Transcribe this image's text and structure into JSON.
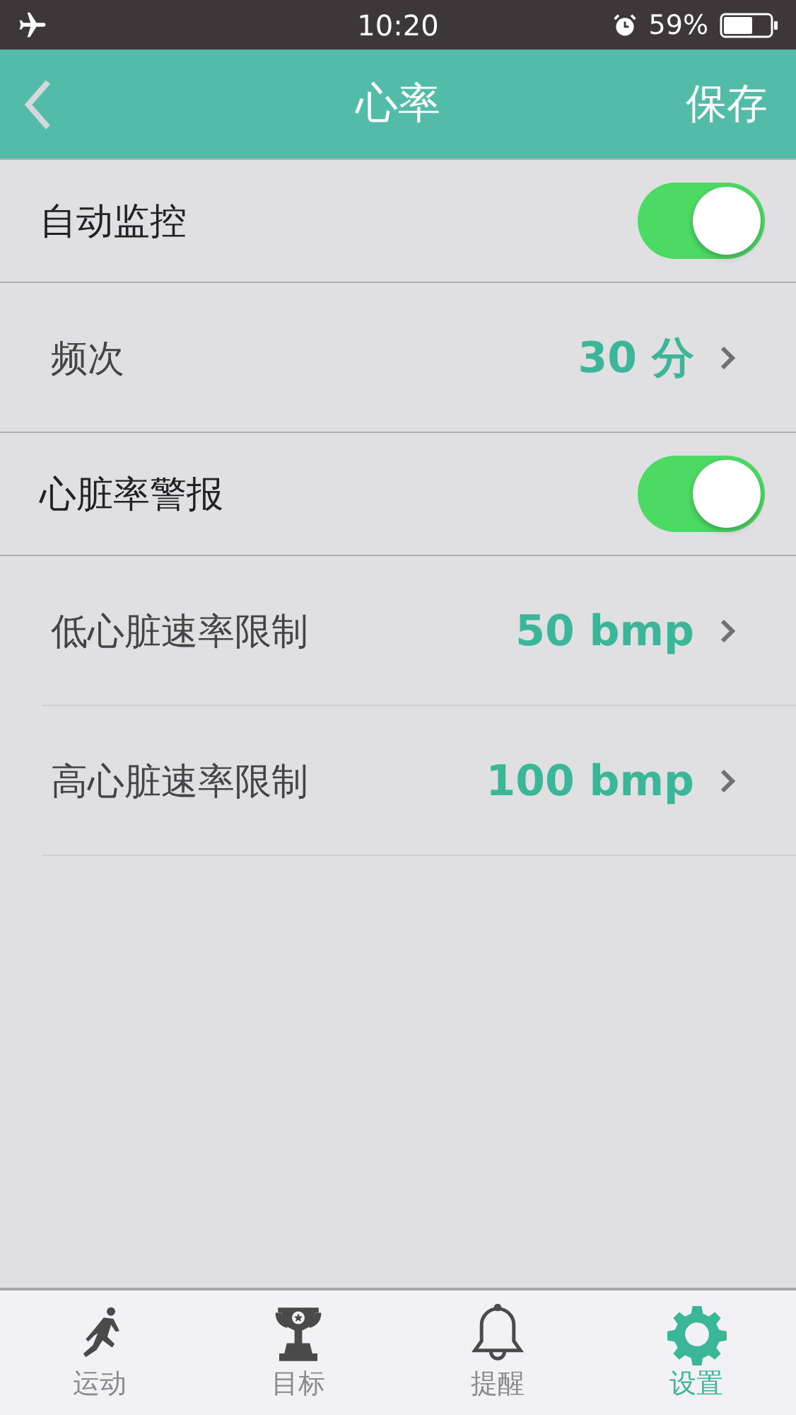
{
  "status_bar": {
    "time": "10:20",
    "battery_text": "59%"
  },
  "nav": {
    "title": "心率",
    "action": "保存"
  },
  "rows": [
    {
      "kind": "toggle",
      "label": "自动监控",
      "on": true
    },
    {
      "kind": "value",
      "label": "频次",
      "value": "30 分"
    },
    {
      "kind": "toggle",
      "label": "心脏率警报",
      "on": true
    },
    {
      "kind": "value",
      "label": "低心脏速率限制",
      "value": "50 bmp"
    },
    {
      "kind": "value",
      "label": "高心脏速率限制",
      "value": "100 bmp"
    }
  ],
  "tabs": [
    {
      "kind": "run",
      "label": "运动",
      "selected": false
    },
    {
      "kind": "trophy",
      "label": "目标",
      "selected": false
    },
    {
      "kind": "bell",
      "label": "提醒",
      "selected": false
    },
    {
      "kind": "gear",
      "label": "设置",
      "selected": true
    }
  ]
}
